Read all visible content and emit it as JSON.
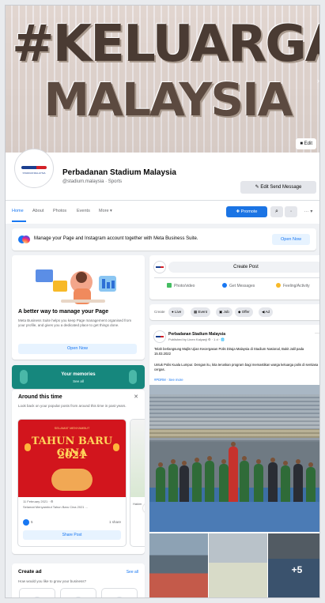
{
  "cover": {
    "line1": "#KELUARGA",
    "line2": "MALAYSIA",
    "edit_label": "Edit",
    "next_arrow": "›"
  },
  "profile": {
    "logo_text": "STADIUM MALAYSIA",
    "name": "Perbadanan Stadium Malaysia",
    "handle": "@stadium.malaysia · Sports",
    "send_message_label": "✎ Edit Send Message"
  },
  "tabs": {
    "items": [
      "Home",
      "About",
      "Photos",
      "Events",
      "More ▾"
    ],
    "promote_label": "✚ Promote",
    "search_icon": "search-icon",
    "more_label": "··· ▾"
  },
  "banner": {
    "text": "Manage your Page and Instagram account together with Meta Business Suite.",
    "button": "Open Now"
  },
  "manage_card": {
    "title": "A better way to manage your Page",
    "description": "Meta Business Suite helps you keep Page management organised from your profile, and gives you a dedicated place to get things done.",
    "button": "Open Now"
  },
  "memories_card": {
    "title": "Your memories",
    "subtitle": "See all"
  },
  "around": {
    "title": "Around this time",
    "description": "Look back on your popular posts from around this time in past years.",
    "close": "✕",
    "item": {
      "top_line": "SELAMAT MENYAMBUT",
      "headline": "TAHUN BARU CINA",
      "year": "2021",
      "date": "11 February 2021 · ⚙",
      "caption": "Selamat Menyambut Tahun Baru Cina 2021 ...",
      "reactions": "5",
      "shares": "1 share",
      "share_button": "Share Post"
    },
    "item2_caption": "Hakim",
    "next": "›"
  },
  "create_ad": {
    "title": "Create ad",
    "see_all": "See all",
    "question": "How would you like to grow your business?"
  },
  "create_post": {
    "button": "Create Post",
    "actions": [
      "Photo/video",
      "Get Messages",
      "Feeling/Activity"
    ],
    "action_colors": [
      "#45bd62",
      "#1877f2",
      "#f7b928"
    ]
  },
  "create_bar": {
    "label": "Create",
    "chips": [
      "Live",
      "Event",
      "Job",
      "Offer",
      "Ad"
    ]
  },
  "post": {
    "author": "Perbadanan Stadium Malaysia",
    "meta": "Published by Linen Kalyanji ⚙ · 1 d · 🌐",
    "text1": "Telah berlangsung Majlis Ujian Kecergasan Polis Diraja Malaysia di Stadium Nasional, Bukit Jalil pada 15.03.2022",
    "text2": "Untuk Polis Kuala Lumpur. Dengan itu, kita teruskan program bagi memastikan warga keluarga polis di sentiasa cergas.",
    "tag": "#PDRM · See more",
    "more_photos": "+5"
  }
}
